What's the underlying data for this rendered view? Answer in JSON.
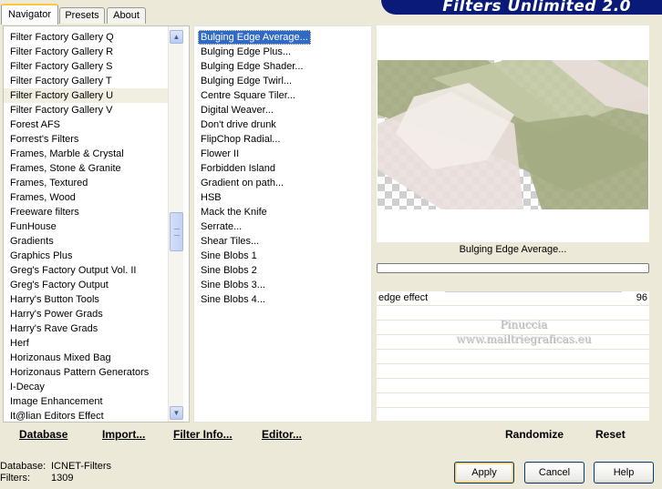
{
  "tabs": [
    {
      "label": "Navigator",
      "active": true
    },
    {
      "label": "Presets",
      "active": false
    },
    {
      "label": "About",
      "active": false
    }
  ],
  "app_title": "Filters Unlimited 2.0",
  "categories": {
    "items": [
      "Filter Factory Gallery Q",
      "Filter Factory Gallery R",
      "Filter Factory Gallery S",
      "Filter Factory Gallery T",
      "Filter Factory Gallery U",
      "Filter Factory Gallery V",
      "Forest AFS",
      "Forrest's Filters",
      "Frames, Marble & Crystal",
      "Frames, Stone & Granite",
      "Frames, Textured",
      "Frames, Wood",
      "Freeware filters",
      "FunHouse",
      "Gradients",
      "Graphics Plus",
      "Greg's Factory Output Vol. II",
      "Greg's Factory Output",
      "Harry's Button Tools",
      "Harry's Power Grads",
      "Harry's Rave Grads",
      "Herf",
      "Horizonaus Mixed Bag",
      "Horizonaus Pattern Generators",
      "I-Decay",
      "Image Enhancement",
      "It@lian Editors Effect"
    ],
    "selected": "Filter Factory Gallery U"
  },
  "filters": {
    "items": [
      "Bulging Edge Average...",
      "Bulging Edge Plus...",
      "Bulging Edge Shader...",
      "Bulging Edge Twirl...",
      "Centre Square Tiler...",
      "Digital Weaver...",
      "Don't drive drunk",
      "FlipChop Radial...",
      "Flower II",
      "Forbidden Island",
      "Gradient on path...",
      "HSB",
      "Mack the Knife",
      "Serrate...",
      "Shear Tiles...",
      "Sine Blobs 1",
      "Sine Blobs 2",
      "Sine Blobs 3...",
      "Sine Blobs 4..."
    ],
    "selected": "Bulging Edge Average..."
  },
  "preview": {
    "filter_name": "Bulging Edge Average...",
    "colors": {
      "olive": "#a4ab82",
      "sage": "#c2c9a4",
      "pink": "#e9dedb",
      "pale": "#f5efec"
    }
  },
  "params": {
    "rows": [
      {
        "name": "edge effect",
        "value": "96"
      }
    ],
    "watermark": [
      "Pinuccia",
      "www.mailtriegraficas.eu"
    ]
  },
  "buttons": {
    "database": "Database",
    "import": "Import...",
    "filter_info": "Filter Info...",
    "editor": "Editor...",
    "randomize": "Randomize",
    "reset": "Reset",
    "apply": "Apply",
    "cancel": "Cancel",
    "help": "Help"
  },
  "status": {
    "database_label": "Database:",
    "database_value": "ICNET-Filters",
    "filters_label": "Filters:",
    "filters_value": "1309"
  },
  "scrollbar": {
    "up_icon": "▲",
    "down_icon": "▼",
    "position_fraction": 0.45
  }
}
